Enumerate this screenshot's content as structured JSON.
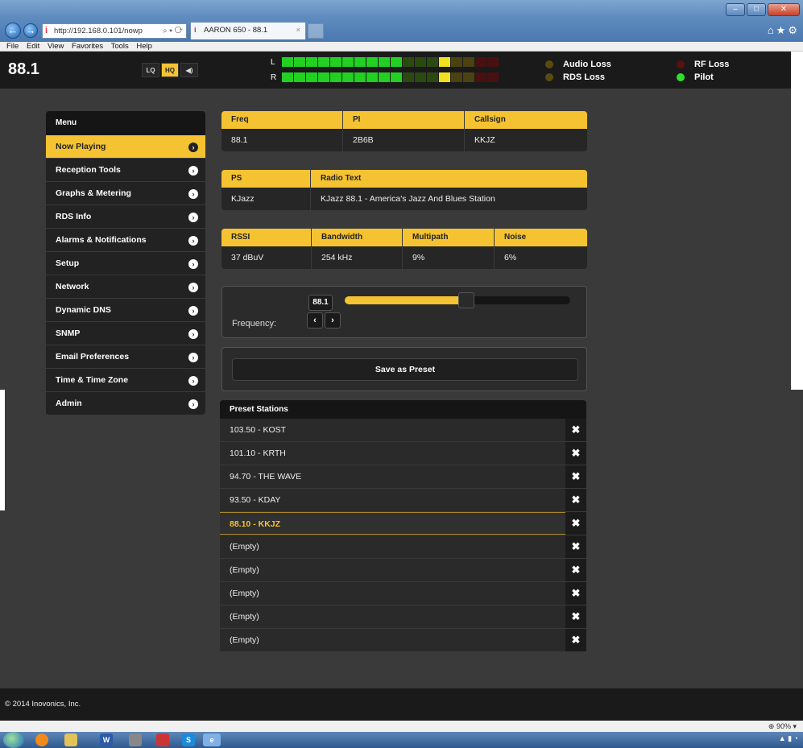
{
  "browser": {
    "url": "http://192.168.0.101/nowp",
    "tab_title": "AARON 650 - 88.1",
    "menu": [
      "File",
      "Edit",
      "View",
      "Favorites",
      "Tools",
      "Help"
    ],
    "zoom": "90%"
  },
  "header": {
    "frequency": "88.1",
    "quality_buttons": [
      "LQ",
      "HQ"
    ],
    "active_quality": "HQ",
    "meter_labels": [
      "L",
      "R"
    ],
    "status": [
      {
        "label": "Audio Loss",
        "color": "#5a4a10"
      },
      {
        "label": "RDS Loss",
        "color": "#5a4a10"
      },
      {
        "label": "RF Loss",
        "color": "#5a1010"
      },
      {
        "label": "Pilot",
        "color": "#2ee02e"
      }
    ]
  },
  "sidebar": {
    "title": "Menu",
    "items": [
      {
        "label": "Now Playing",
        "active": true
      },
      {
        "label": "Reception Tools"
      },
      {
        "label": "Graphs & Metering"
      },
      {
        "label": "RDS Info"
      },
      {
        "label": "Alarms & Notifications"
      },
      {
        "label": "Setup"
      },
      {
        "label": "Network"
      },
      {
        "label": "Dynamic DNS"
      },
      {
        "label": "SNMP"
      },
      {
        "label": "Email Preferences"
      },
      {
        "label": "Time & Time Zone"
      },
      {
        "label": "Admin"
      }
    ]
  },
  "info": {
    "freq_label": "Freq",
    "freq_value": "88.1",
    "pi_label": "PI",
    "pi_value": "2B6B",
    "callsign_label": "Callsign",
    "callsign_value": "KKJZ",
    "ps_label": "PS",
    "ps_value": "KJazz",
    "rt_label": "Radio Text",
    "rt_value": "KJazz 88.1 - America's Jazz And Blues Station",
    "rssi_label": "RSSI",
    "rssi_value": "37 dBuV",
    "bw_label": "Bandwidth",
    "bw_value": "254 kHz",
    "mp_label": "Multipath",
    "mp_value": "9%",
    "noise_label": "Noise",
    "noise_value": "6%"
  },
  "tuner": {
    "label": "Frequency:",
    "value": "88.1",
    "slider_fraction": 0.54,
    "prev": "‹",
    "next": "›",
    "save_label": "Save as Preset"
  },
  "presets": {
    "title": "Preset Stations",
    "items": [
      {
        "label": "103.50 - KOST"
      },
      {
        "label": "101.10 - KRTH"
      },
      {
        "label": "94.70 - THE WAVE"
      },
      {
        "label": "93.50 - KDAY"
      },
      {
        "label": "88.10 - KKJZ",
        "selected": true
      },
      {
        "label": "(Empty)"
      },
      {
        "label": "(Empty)"
      },
      {
        "label": "(Empty)"
      },
      {
        "label": "(Empty)"
      },
      {
        "label": "(Empty)"
      }
    ]
  },
  "footer": {
    "copyright": "© 2014 Inovonics, Inc."
  }
}
